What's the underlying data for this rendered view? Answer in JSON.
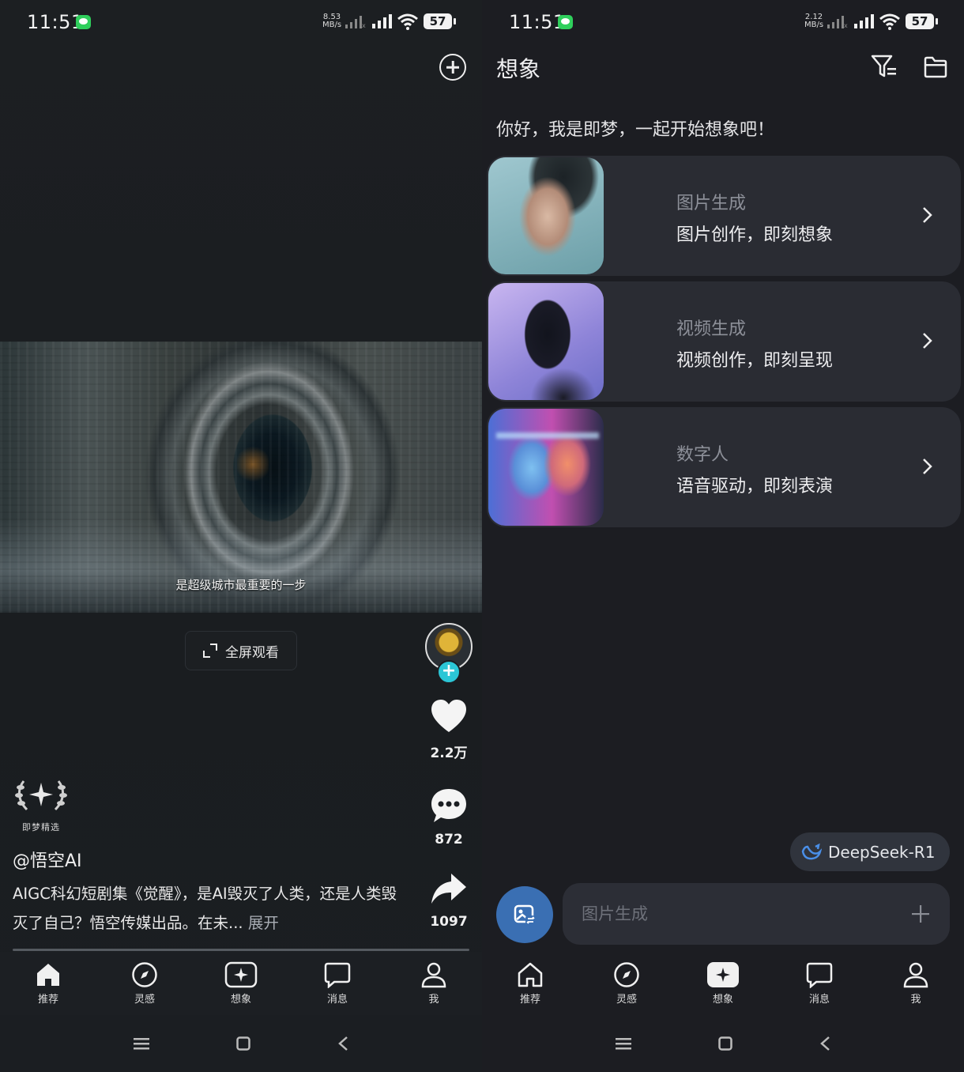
{
  "left": {
    "status": {
      "time": "11:51",
      "speed_top": "8.53",
      "speed_bottom": "MB/s",
      "battery": "57"
    },
    "video": {
      "caption": "是超级城市最重要的一步",
      "fullscreen_label": "全屏观看"
    },
    "actions": {
      "likes": "2.2万",
      "comments": "872",
      "shares": "1097"
    },
    "badge": {
      "label": "即梦精选"
    },
    "author": "@悟空AI",
    "description": "AIGC科幻短剧集《觉醒》，是AI毁灭了人类，还是人类毁灭了自己？悟空传媒出品。在未...",
    "expand": "展开",
    "nav": [
      {
        "label": "推荐",
        "icon": "home-icon"
      },
      {
        "label": "灵感",
        "icon": "compass-icon"
      },
      {
        "label": "想象",
        "icon": "sparkle-icon"
      },
      {
        "label": "消息",
        "icon": "chat-icon"
      },
      {
        "label": "我",
        "icon": "person-icon"
      }
    ]
  },
  "right": {
    "status": {
      "time": "11:51",
      "speed_top": "2.12",
      "speed_bottom": "MB/s",
      "battery": "57"
    },
    "title": "想象",
    "greeting": "你好，我是即梦，一起开始想象吧！",
    "cards": [
      {
        "title": "图片生成",
        "subtitle": "图片创作，即刻想象"
      },
      {
        "title": "视频生成",
        "subtitle": "视频创作，即刻呈现"
      },
      {
        "title": "数字人",
        "subtitle": "语音驱动，即刻表演"
      }
    ],
    "model": "DeepSeek-R1",
    "input": {
      "placeholder": "图片生成"
    },
    "nav": [
      {
        "label": "推荐",
        "icon": "home-icon"
      },
      {
        "label": "灵感",
        "icon": "compass-icon"
      },
      {
        "label": "想象",
        "icon": "sparkle-icon"
      },
      {
        "label": "消息",
        "icon": "chat-icon"
      },
      {
        "label": "我",
        "icon": "person-icon"
      }
    ]
  },
  "colors": {
    "accent_teal": "#2bc6d6",
    "mode_button": "#3a6fb3",
    "card_bg": "#2a2c33"
  }
}
